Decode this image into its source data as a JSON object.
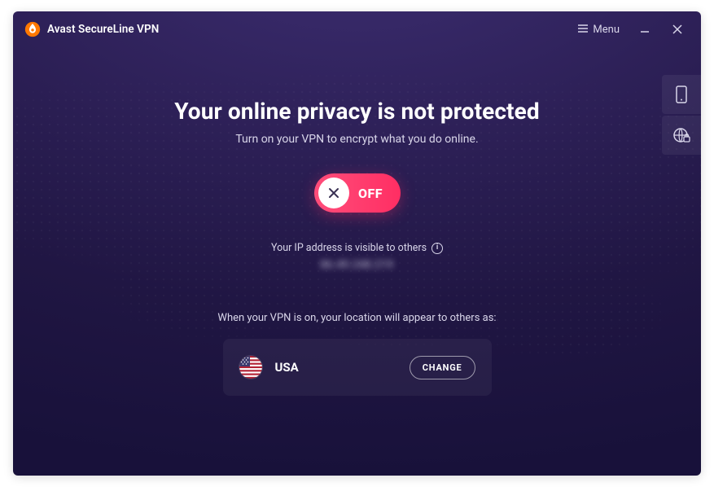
{
  "titlebar": {
    "app_name": "Avast SecureLine VPN",
    "menu_label": "Menu"
  },
  "side_panel": {
    "devices_icon": "smartphone-icon",
    "browser_icon": "globe-lock-icon"
  },
  "main": {
    "headline": "Your online privacy is not protected",
    "subline": "Turn on your VPN to encrypt what you do online.",
    "toggle_state_label": "OFF",
    "toggle_on": false,
    "ip_caption": "Your IP address is visible to others",
    "ip_value": "86.49.248.219",
    "location_caption": "When your VPN is on, your location will appear to others as:",
    "location_country": "USA",
    "change_button_label": "CHANGE"
  },
  "colors": {
    "accent_pink": "#ff2e63",
    "bg_deep_purple": "#201643"
  }
}
